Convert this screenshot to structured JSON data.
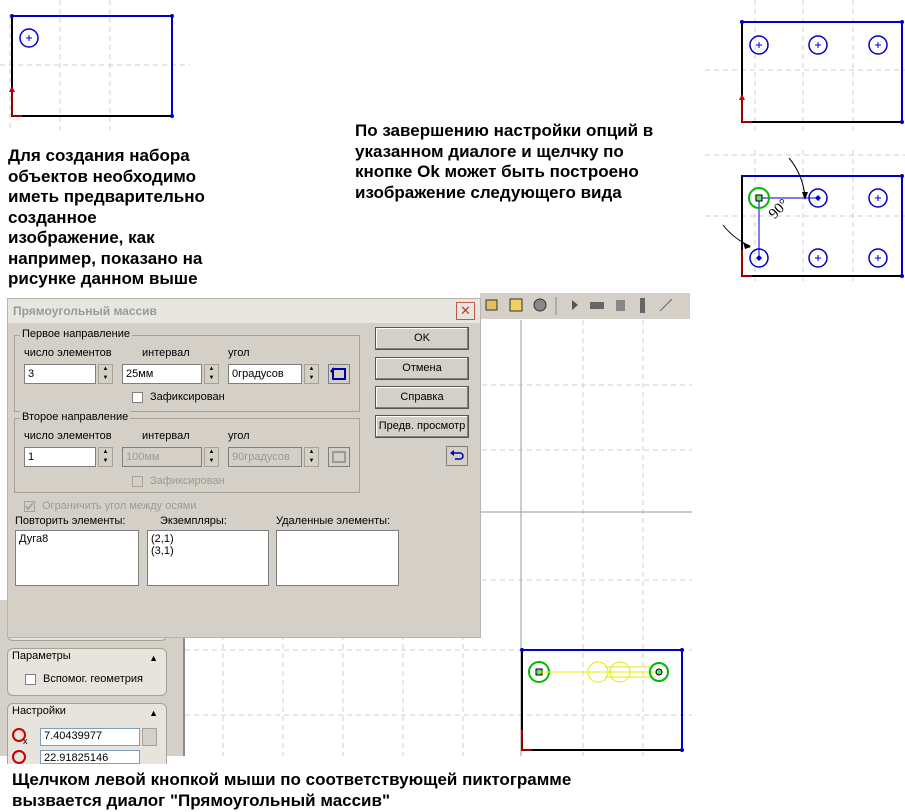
{
  "texts": {
    "left_paragraph": "Для создания набора\nобъектов необходимо\nиметь предварительно\nсозданное\nизображение, как\nнапример, показано на\nрисунке данном выше",
    "right_paragraph": "По завершению настройки опций в\nуказанном диалоге и щелчку по\nкнопке Ok может быть построено\nизображение следующего вида",
    "bottom_paragraph": "Щелчком левой кнопкой мыши по соответствующей пиктограмме\nвызвается диалог \"Прямоугольный массив\""
  },
  "diagram": {
    "angle_label": "90°"
  },
  "dialog": {
    "title": "Прямоугольный массив",
    "close_symbol": "✕",
    "first_direction": {
      "label": "Первое направление",
      "count_label": "число элементов",
      "interval_label": "интервал",
      "angle_label": "угол",
      "count_value": "3",
      "interval_value": "25мм",
      "angle_value": "0градусов",
      "fixed_label": "Зафиксирован"
    },
    "second_direction": {
      "label": "Второе направление",
      "count_label": "число элементов",
      "interval_label": "интервал",
      "angle_label": "угол",
      "count_value": "1",
      "interval_value": "100мм",
      "angle_value": "90градусов",
      "fixed_label": "Зафиксирован"
    },
    "limit_angle_label": "Ограничить угол между осями",
    "repeat_label": "Повторить элементы:",
    "instances_label": "Экземпляры:",
    "deleted_label": "Удаленные элементы:",
    "repeat_items": [
      "Дуга8"
    ],
    "instance_items": [
      "(2,1)",
      "(3,1)"
    ],
    "buttons": {
      "ok": "OK",
      "cancel": "Отмена",
      "help": "Справка",
      "preview": "Предв. просмотр"
    }
  },
  "left_panel": {
    "params_title": "Параметры",
    "aux_geometry_label": "Вспомог. геометрия",
    "settings_title": "Настройки",
    "x_value": "7.40439977",
    "y_value": "22.91825146",
    "x_sub": "x"
  },
  "colors": {
    "blue": "#0000cc",
    "red": "#cc0000",
    "green": "#00aa00",
    "yellow": "#e8e800",
    "dialog_bg": "#d4d0c8"
  }
}
